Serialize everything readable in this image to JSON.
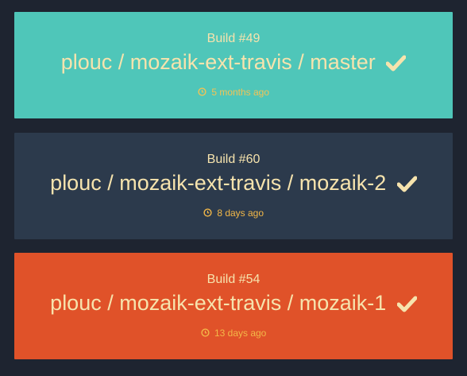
{
  "builds": [
    {
      "build_label": "Build #49",
      "repo_path": "plouc / mozaik-ext-travis / master",
      "status_icon": "check-icon",
      "time_ago": "5 months ago",
      "bg_color": "#4fc6b9"
    },
    {
      "build_label": "Build #60",
      "repo_path": "plouc / mozaik-ext-travis / mozaik-2",
      "status_icon": "check-icon",
      "time_ago": "8 days ago",
      "bg_color": "#2c3a4c"
    },
    {
      "build_label": "Build #54",
      "repo_path": "plouc / mozaik-ext-travis / mozaik-1",
      "status_icon": "check-icon",
      "time_ago": "13 days ago",
      "bg_color": "#e05229"
    }
  ],
  "colors": {
    "page_background": "#1e2430",
    "text": "#f6e3ad",
    "time_text": "#f3b848"
  }
}
